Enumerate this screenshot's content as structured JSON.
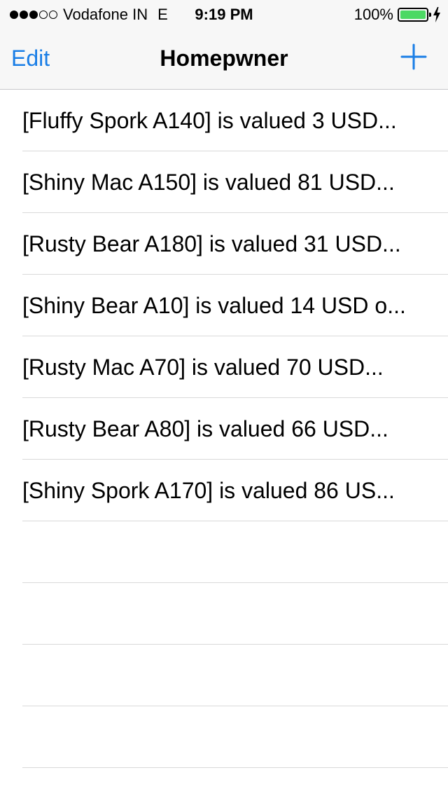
{
  "status_bar": {
    "carrier": "Vodafone IN",
    "network": "E",
    "time": "9:19 PM",
    "battery_percent": "100%",
    "battery_level": 1.0,
    "signal_bars_filled": 3,
    "signal_bars_total": 5,
    "battery_color": "#4cd964"
  },
  "nav": {
    "left_button": "Edit",
    "title": "Homepwner",
    "right_icon": "plus-icon",
    "accent_color": "#1a7ee6"
  },
  "items": [
    {
      "label": "[Fluffy Spork A140] is valued 3 USD..."
    },
    {
      "label": "[Shiny Mac A150] is valued 81 USD..."
    },
    {
      "label": "[Rusty Bear A180] is valued 31 USD..."
    },
    {
      "label": "[Shiny Bear A10] is valued 14 USD o..."
    },
    {
      "label": "[Rusty Mac A70] is valued 70 USD..."
    },
    {
      "label": "[Rusty Bear A80] is valued 66 USD..."
    },
    {
      "label": "[Shiny Spork A170] is valued 86 US..."
    }
  ]
}
